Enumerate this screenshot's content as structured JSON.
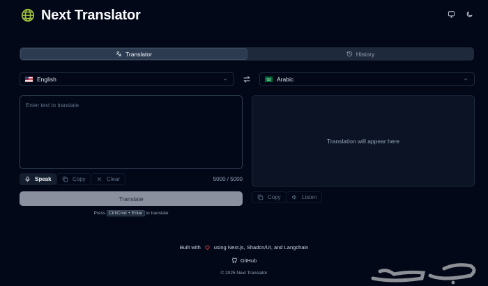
{
  "app": {
    "title": "Next Translator",
    "logo_icon": "globe-icon",
    "accent": "#a3c43a"
  },
  "header": {
    "icons": [
      "monitor-icon",
      "moon-icon"
    ]
  },
  "tabs": [
    {
      "label": "Translator",
      "icon": "languages-icon",
      "active": true
    },
    {
      "label": "History",
      "icon": "history-icon",
      "active": false
    }
  ],
  "languages": {
    "source": {
      "label": "English",
      "flag": "us-flag-icon"
    },
    "target": {
      "label": "Arabic",
      "flag": "sa-flag-icon"
    },
    "swap_icon": "swap-icon"
  },
  "source": {
    "placeholder": "Enter text to translate",
    "value": "",
    "count": "5000 / 5000"
  },
  "source_actions": {
    "speak": "Speak",
    "copy": "Copy",
    "clear": "Clear"
  },
  "translate_label": "Translate",
  "hint": {
    "before": "Press",
    "keys": "Ctrl/Cmd + Enter",
    "after": "to translate"
  },
  "output": {
    "placeholder": "Translation will appear here",
    "actions": {
      "copy": "Copy",
      "listen": "Listen"
    }
  },
  "footer": {
    "built_with": "Built with",
    "built_tail": "using Next.js, Shadcn/UI, and Langchain",
    "github": "GitHub",
    "copyright": "© 2025 Next Translator"
  },
  "colors": {
    "background": "#020817",
    "panel": "#1e293b",
    "heart": "#ef4444",
    "button": "#8a909e"
  }
}
